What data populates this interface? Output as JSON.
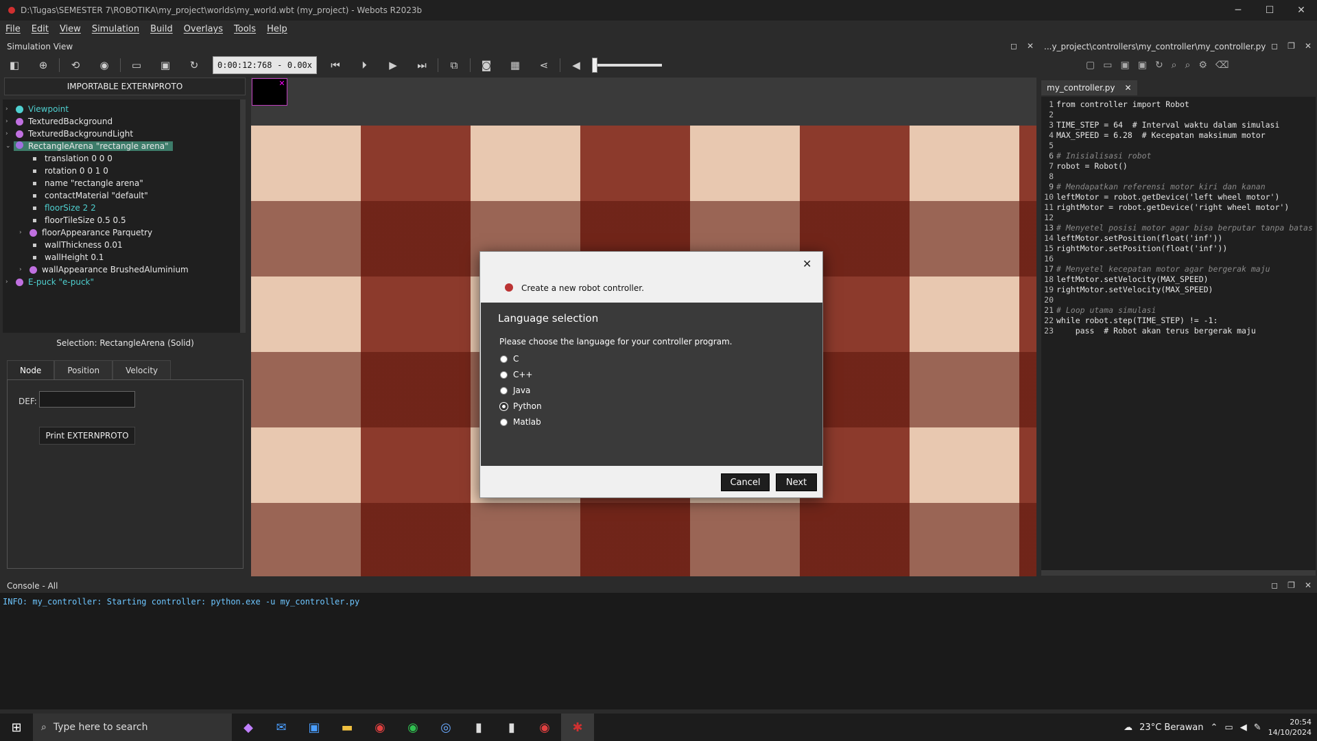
{
  "window": {
    "title": "D:\\Tugas\\SEMESTER 7\\ROBOTIKA\\my_project\\worlds\\my_world.wbt (my_project) - Webots R2023b",
    "min": "─",
    "max": "☐",
    "close": "✕"
  },
  "menu": [
    "File",
    "Edit",
    "View",
    "Simulation",
    "Build",
    "Overlays",
    "Tools",
    "Help"
  ],
  "sim_view": {
    "title": "Simulation View",
    "time": "0:00:12:768",
    "dash": "-",
    "speed": "0.00x"
  },
  "scene": {
    "import_label": "IMPORTABLE EXTERNPROTO",
    "nodes": [
      {
        "label": "Viewpoint",
        "color": "#4fd0d0"
      },
      {
        "label": "TexturedBackground",
        "color": "#c070e0"
      },
      {
        "label": "TexturedBackgroundLight",
        "color": "#c070e0"
      },
      {
        "label": "RectangleArena \"rectangle arena\"",
        "color": "#a070e0"
      },
      {
        "label": "translation 0 0 0"
      },
      {
        "label": "rotation 0 0 1 0"
      },
      {
        "label": "name \"rectangle arena\""
      },
      {
        "label": "contactMaterial \"default\""
      },
      {
        "label": "floorSize 2 2"
      },
      {
        "label": "floorTileSize 0.5 0.5"
      },
      {
        "label": "floorAppearance Parquetry",
        "color": "#c070e0"
      },
      {
        "label": "wallThickness 0.01"
      },
      {
        "label": "wallHeight 0.1"
      },
      {
        "label": "wallAppearance BrushedAluminium",
        "color": "#c070e0"
      },
      {
        "label": "E-puck \"e-puck\"",
        "color": "#c070e0"
      }
    ],
    "selection": "Selection: RectangleArena (Solid)",
    "tabs": [
      "Node",
      "Position",
      "Velocity"
    ],
    "def_label": "DEF:",
    "print_label": "Print EXTERNPROTO"
  },
  "editor": {
    "path": "...y_project\\controllers\\my_controller\\my_controller.py",
    "tab": "my_controller.py",
    "tab_close": "✕",
    "lines": [
      "from controller import Robot",
      "",
      "TIME_STEP = 64  # Interval waktu dalam simulasi",
      "MAX_SPEED = 6.28  # Kecepatan maksimum motor",
      "",
      "# Inisialisasi robot",
      "robot = Robot()",
      "",
      "# Mendapatkan referensi motor kiri dan kanan",
      "leftMotor = robot.getDevice('left wheel motor')",
      "rightMotor = robot.getDevice('right wheel motor')",
      "",
      "# Menyetel posisi motor agar bisa berputar tanpa batas",
      "leftMotor.setPosition(float('inf'))",
      "rightMotor.setPosition(float('inf'))",
      "",
      "# Menyetel kecepatan motor agar bergerak maju",
      "leftMotor.setVelocity(MAX_SPEED)",
      "rightMotor.setVelocity(MAX_SPEED)",
      "",
      "# Loop utama simulasi",
      "while robot.step(TIME_STEP) != -1:",
      "    pass  # Robot akan terus bergerak maju"
    ]
  },
  "console": {
    "title": "Console - All",
    "line": "INFO: my_controller: Starting controller: python.exe -u my_controller.py"
  },
  "dialog": {
    "title": "Create a new robot controller.",
    "heading": "Language selection",
    "prompt": "Please choose the language for your controller program.",
    "options": [
      "C",
      "C++",
      "Java",
      "Python",
      "Matlab"
    ],
    "selected": "Python",
    "cancel": "Cancel",
    "next": "Next",
    "close": "✕"
  },
  "taskbar": {
    "search_placeholder": "Type here to search",
    "weather": "23°C Berawan",
    "time": "20:54",
    "date": "14/10/2024"
  }
}
